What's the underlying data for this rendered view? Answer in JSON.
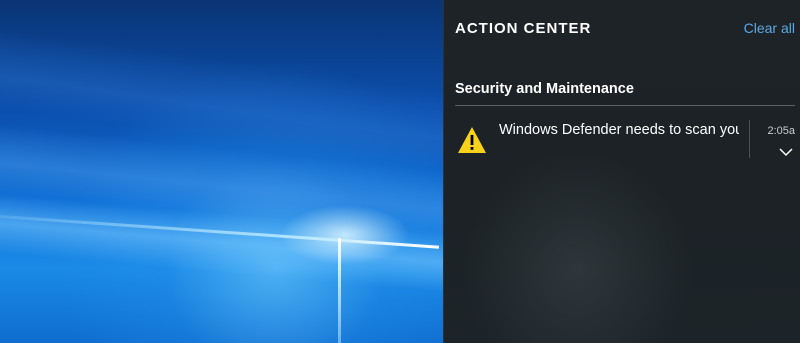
{
  "action_center": {
    "title": "ACTION CENTER",
    "clear_all_label": "Clear all",
    "groups": [
      {
        "title": "Security and Maintenance",
        "notifications": [
          {
            "icon": "warning-icon",
            "text": "Windows Defender needs to scan your PC",
            "time": "2:05a",
            "expand_icon": "chevron-down-icon"
          }
        ]
      }
    ]
  },
  "colors": {
    "panel_background": "#1e2328",
    "accent_link": "#5aa9e6",
    "warning_yellow": "#f7d21b",
    "wallpaper_blue": "#0f6fd6"
  }
}
